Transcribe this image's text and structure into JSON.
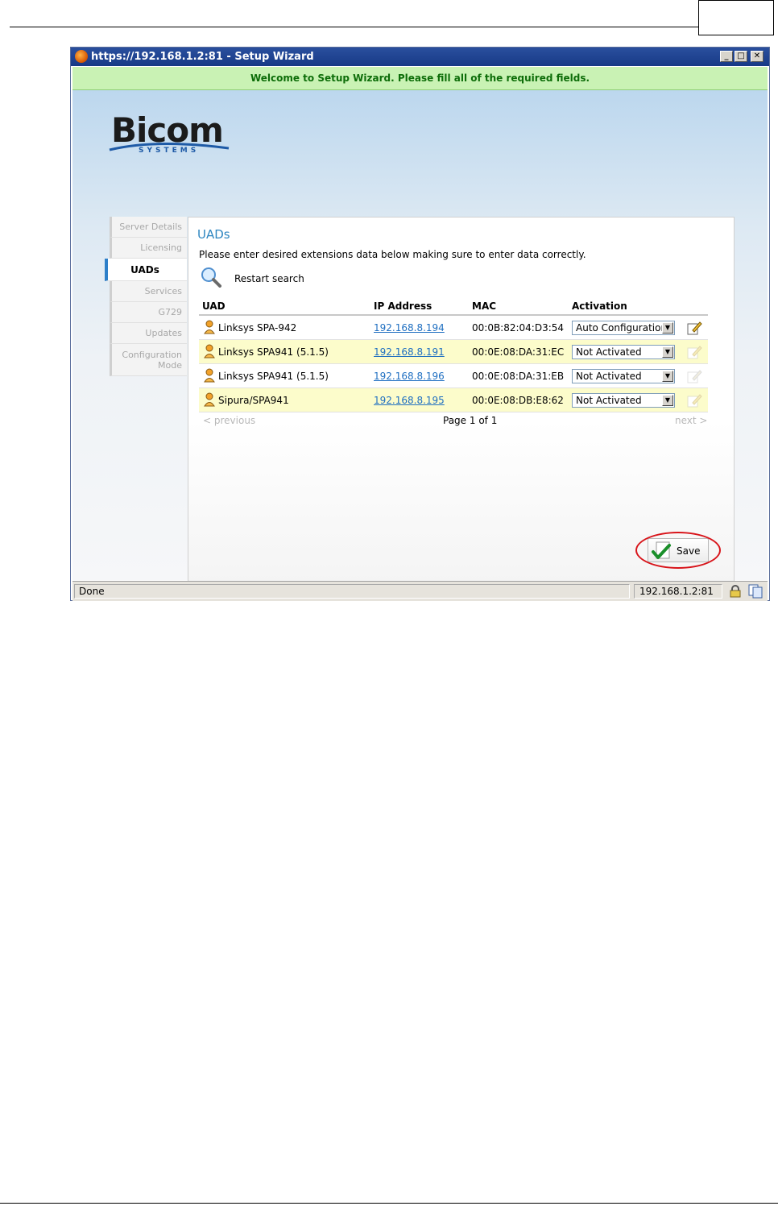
{
  "window": {
    "title": "https://192.168.1.2:81 - Setup Wizard",
    "banner": "Welcome to Setup Wizard. Please fill all of the required fields."
  },
  "logo": {
    "word": "Bicom",
    "sub": "SYSTEMS"
  },
  "nav": {
    "items": [
      {
        "label": "Server Details",
        "active": false
      },
      {
        "label": "Licensing",
        "active": false
      },
      {
        "label": "UADs",
        "active": true
      },
      {
        "label": "Services",
        "active": false
      },
      {
        "label": "G729",
        "active": false
      },
      {
        "label": "Updates",
        "active": false
      },
      {
        "label": "Configuration Mode",
        "active": false
      }
    ]
  },
  "main": {
    "title": "UADs",
    "description": "Please enter desired extensions data below making sure to enter data correctly.",
    "restart_label": "Restart search",
    "table": {
      "headers": [
        "UAD",
        "IP Address",
        "MAC",
        "Activation"
      ],
      "rows": [
        {
          "uad": "Linksys SPA-942",
          "ip": "192.168.8.194",
          "mac": "00:0B:82:04:D3:54",
          "activation": "Auto Configuration"
        },
        {
          "uad": "Linksys SPA941 (5.1.5)",
          "ip": "192.168.8.191",
          "mac": "00:0E:08:DA:31:EC",
          "activation": "Not Activated"
        },
        {
          "uad": "Linksys SPA941 (5.1.5)",
          "ip": "192.168.8.196",
          "mac": "00:0E:08:DA:31:EB",
          "activation": "Not Activated"
        },
        {
          "uad": "Sipura/SPA941",
          "ip": "192.168.8.195",
          "mac": "00:0E:08:DB:E8:62",
          "activation": "Not Activated"
        }
      ]
    },
    "pager": {
      "previous": "< previous",
      "page": "Page 1 of 1",
      "next": "next >"
    },
    "save_label": "Save"
  },
  "statusbar": {
    "status": "Done",
    "host": "192.168.1.2:81"
  },
  "colors": {
    "accent": "#2e86c1",
    "banner_bg": "#c9f2b4",
    "banner_text": "#0d6d09",
    "highlight_row": "#fcfccb",
    "annotation_ring": "#d8141a"
  }
}
